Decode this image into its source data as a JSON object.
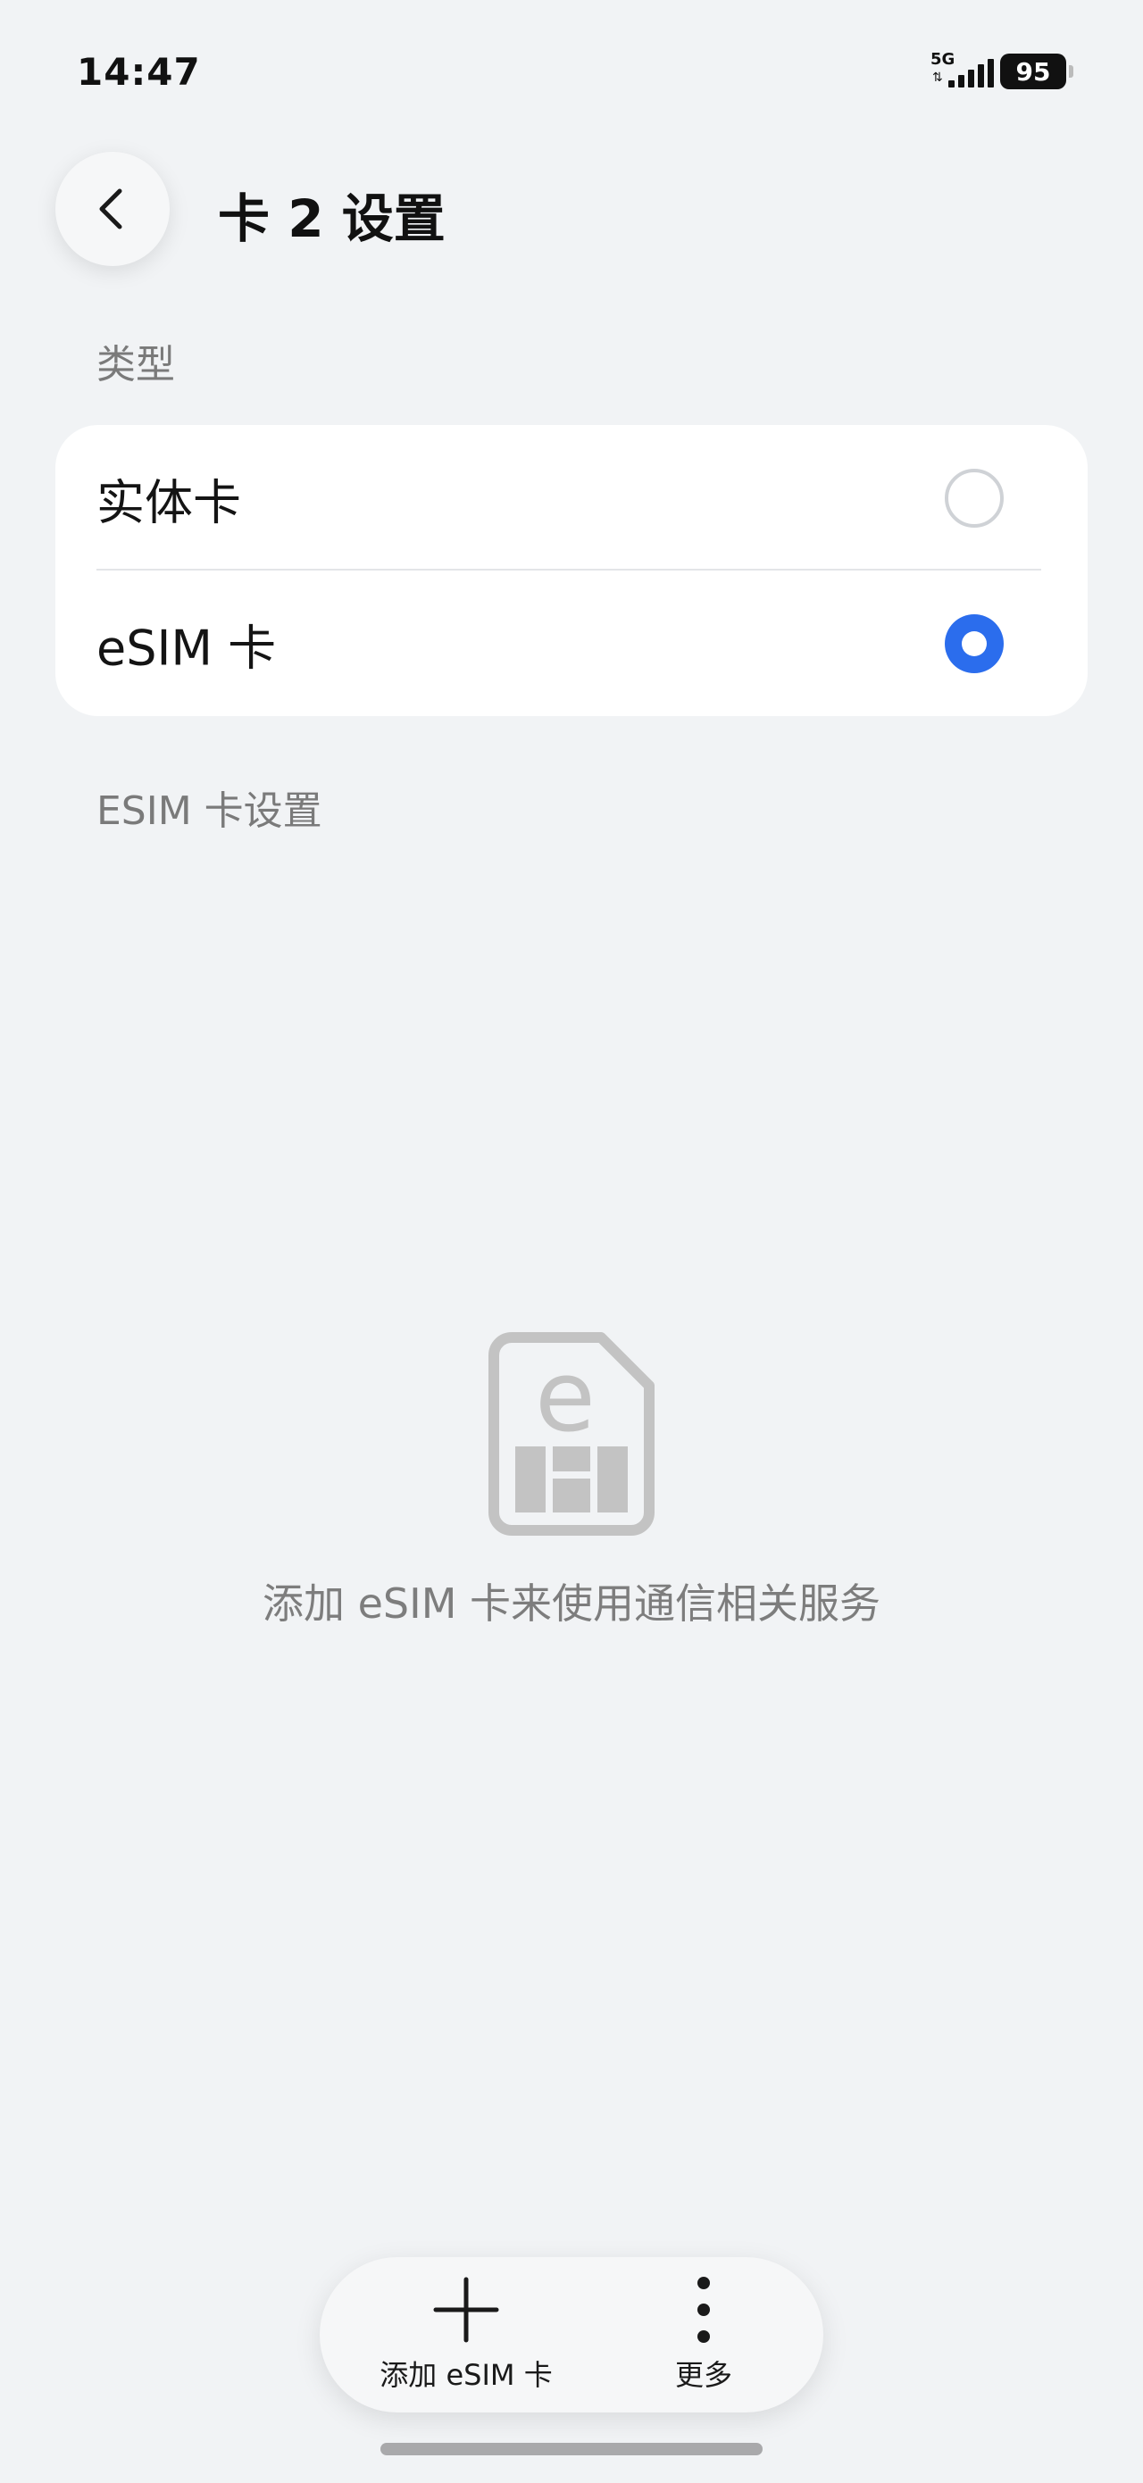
{
  "status_bar": {
    "time": "14:47",
    "network": "5G",
    "battery": "95"
  },
  "header": {
    "title": "卡 2 设置"
  },
  "type_section": {
    "label": "类型",
    "options": [
      {
        "label": "实体卡",
        "selected": false
      },
      {
        "label": "eSIM 卡",
        "selected": true
      }
    ]
  },
  "esim_section": {
    "label": "ESIM 卡设置",
    "empty_text": "添加 eSIM 卡来使用通信相关服务",
    "icon": "esim-card-icon"
  },
  "bottom_bar": {
    "add_label": "添加 eSIM 卡",
    "more_label": "更多"
  },
  "colors": {
    "accent": "#2b6ded",
    "background": "#f1f3f5",
    "card": "#ffffff"
  }
}
